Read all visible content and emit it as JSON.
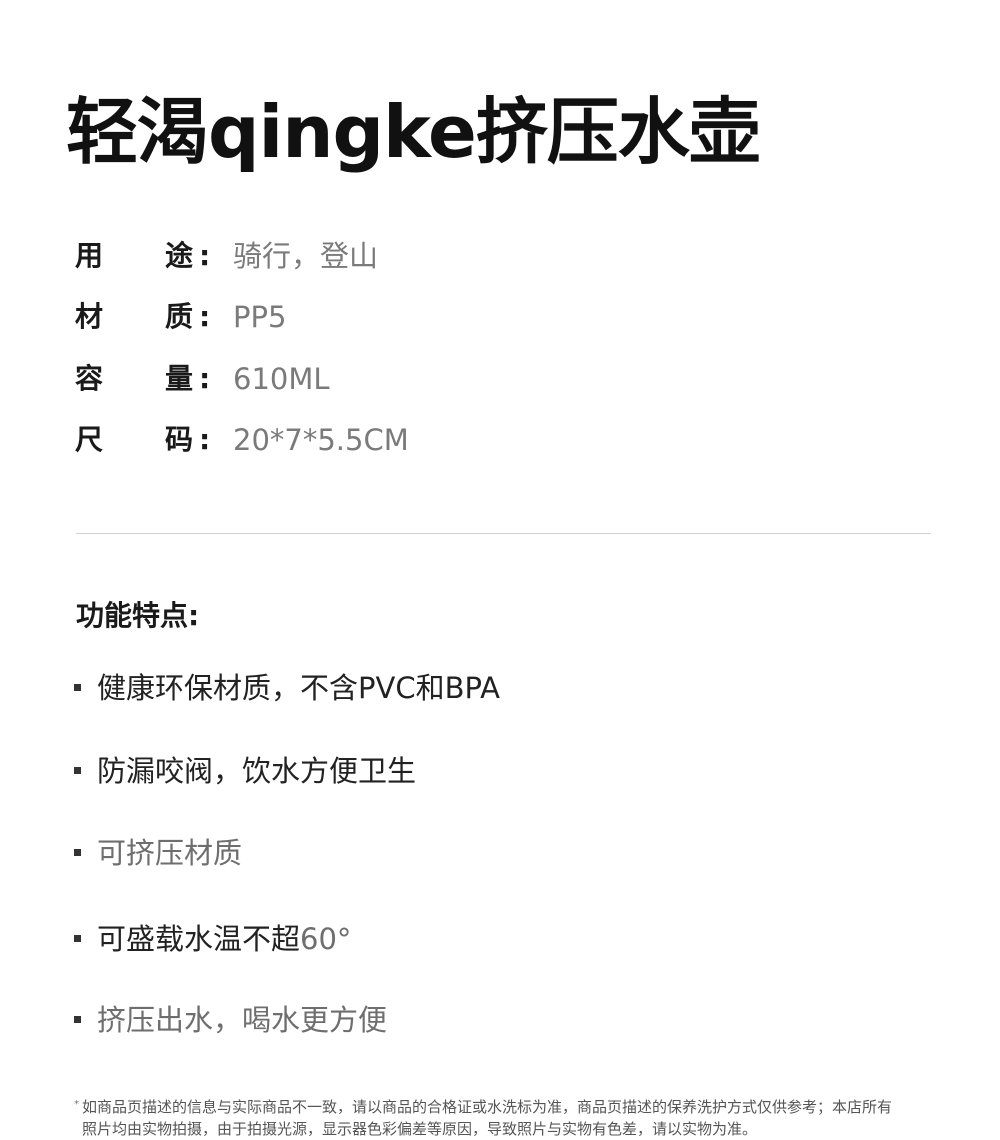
{
  "title": "轻渴qingke挤压水壶",
  "specs": [
    {
      "k1": "用",
      "k2": "途",
      "colon": ":",
      "value": "骑行，登山"
    },
    {
      "k1": "材",
      "k2": "质",
      "colon": ":",
      "value": "PP5"
    },
    {
      "k1": "容",
      "k2": "量",
      "colon": ":",
      "value": "610ML"
    },
    {
      "k1": "尺",
      "k2": "码",
      "colon": ":",
      "value": "20*7*5.5CM"
    }
  ],
  "features": {
    "heading": "功能特点:",
    "items": [
      {
        "text": "健康环保材质，不含PVC和BPA"
      },
      {
        "text": "防漏咬阀，饮水方便卫生"
      },
      {
        "text": "可挤压材质"
      },
      {
        "text": "可盛载水温不超",
        "suffix": "60°"
      },
      {
        "text": "挤压出水，喝水更方便"
      }
    ]
  },
  "disclaimer": {
    "marker": "*",
    "line1": "如商品页描述的信息与实际商品不一致，请以商品的合格证或水洗标为准，商品页描述的保养洗护方式仅供参考；本店所有",
    "line2": "照片均由实物拍摄，由于拍摄光源，显示器色彩偏差等原因，导致照片与实物有色差，请以实物为准。"
  }
}
